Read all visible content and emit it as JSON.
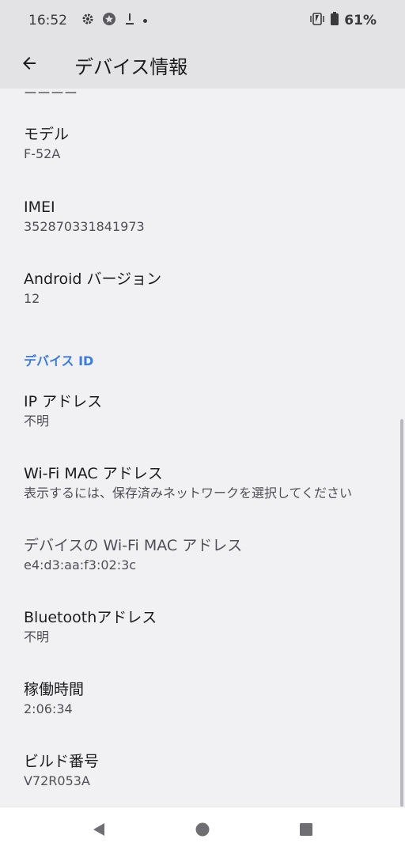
{
  "status_bar": {
    "time": "16:52",
    "battery_percent": "61%",
    "icons": [
      "gear-icon",
      "star-badge-icon",
      "download-icon",
      "dot-icon",
      "vibrate-icon",
      "battery-icon"
    ]
  },
  "app_bar": {
    "title": "デバイス情報",
    "back_icon": "arrow-back-icon"
  },
  "partial_row_text": "ーーーー",
  "items_top": [
    {
      "title": "モデル",
      "summary": "F-52A"
    },
    {
      "title": "IMEI",
      "summary": "352870331841973"
    },
    {
      "title": "Android バージョン",
      "summary": "12"
    }
  ],
  "section": {
    "title": "デバイス ID"
  },
  "items_device_id": [
    {
      "title": "IP アドレス",
      "summary": "不明"
    },
    {
      "title": "Wi-Fi MAC アドレス",
      "summary": "表示するには、保存済みネットワークを選択してください"
    },
    {
      "title": "デバイスの Wi-Fi MAC アドレス",
      "summary": "e4:d3:aa:f3:02:3c"
    },
    {
      "title": "Bluetoothアドレス",
      "summary": "不明"
    },
    {
      "title": "稼働時間",
      "summary": "2:06:34"
    },
    {
      "title": "ビルド番号",
      "summary": "V72R053A"
    }
  ],
  "nav_bar": {
    "icons": [
      "back-triangle-icon",
      "home-circle-icon",
      "recents-square-icon"
    ]
  },
  "colors": {
    "accent": "#3b7dd8",
    "background": "#f1f1f4",
    "bar": "#e3e3e6"
  }
}
